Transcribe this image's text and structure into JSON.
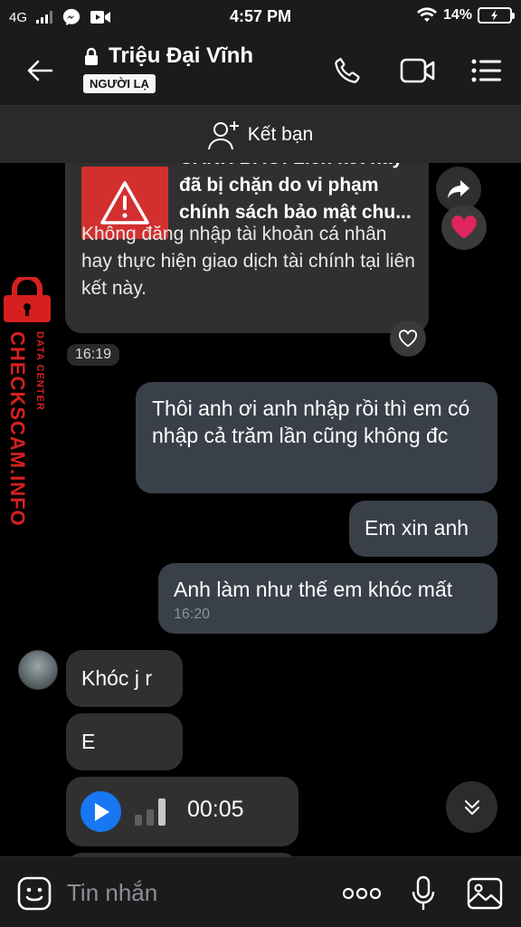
{
  "status_bar": {
    "network": "4G",
    "time": "4:57 PM",
    "battery": "14%"
  },
  "header": {
    "title": "Triệu Đại Vĩnh",
    "badge": "NGƯỜI LẠ"
  },
  "friend_bar": {
    "label": "Kết bạn"
  },
  "chat": {
    "warning_card": {
      "title": "CẢNH BÁO: Liên kết này đã bị chặn do vi phạm chính sách bảo mật chu...",
      "description": "Không đăng nhập tài khoản cá nhân hay thực hiện giao dịch tài chính tại liên kết này."
    },
    "time_label": "16:19",
    "outgoing": [
      {
        "text": "Thôi anh ơi anh nhập rồi thì em có nhập cả trăm lần cũng không đc"
      },
      {
        "text": "Em xin anh"
      },
      {
        "text": "Anh làm như thế em khóc mất",
        "time": "16:20"
      }
    ],
    "incoming": [
      {
        "text": "Khóc j r"
      },
      {
        "text": "E"
      }
    ],
    "audio": {
      "duration": "00:05"
    }
  },
  "composer": {
    "placeholder": "Tin nhắn"
  },
  "watermark": {
    "main": "CHECKSCAM.INFO",
    "sub": "DATA CENTER"
  },
  "colors": {
    "accent_blue": "#1877f2",
    "heart_red": "#e0245e",
    "warning_red": "#d32f2f"
  },
  "icons": {
    "back": "back-arrow-icon",
    "lock": "lock-icon",
    "call": "phone-icon",
    "video": "video-camera-icon",
    "menu": "menu-icon",
    "add_friend": "add-person-icon",
    "share": "share-icon",
    "heart": "heart-icon",
    "like": "heart-outline-icon",
    "play": "play-icon",
    "scroll_down": "chevron-double-down-icon",
    "emoji": "emoji-icon",
    "more": "more-dots-icon",
    "mic": "microphone-icon",
    "image": "image-icon"
  }
}
